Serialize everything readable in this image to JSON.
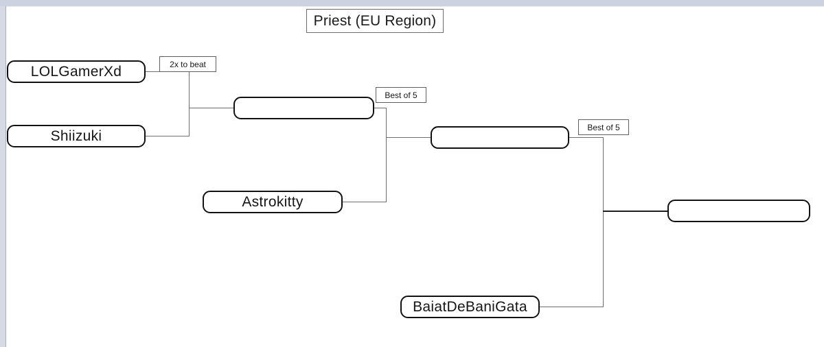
{
  "window": {
    "chrome_color": "#ccd2e0",
    "rail_color": "#d6dae4",
    "canvas_color": "#ffffff"
  },
  "bracket": {
    "title": "Priest (EU Region)",
    "line_color": "#6d6d6d",
    "box_border_color": "#111111",
    "rounds": [
      {
        "name": "round-1",
        "slots": [
          {
            "id": "slot-lolgamerxd",
            "label": "LOLGamerXd"
          },
          {
            "id": "slot-shiizuki",
            "label": "Shiizuki"
          }
        ]
      },
      {
        "name": "round-2",
        "slots": [
          {
            "id": "slot-r2-winner",
            "label": ""
          },
          {
            "id": "slot-astrokitty",
            "label": "Astrokitty"
          }
        ]
      },
      {
        "name": "round-3",
        "slots": [
          {
            "id": "slot-r3-winner",
            "label": ""
          },
          {
            "id": "slot-baiatdebanigata",
            "label": "BaiatDeBaniGata"
          }
        ]
      },
      {
        "name": "final",
        "slots": [
          {
            "id": "slot-champion",
            "label": ""
          }
        ]
      }
    ],
    "notes": [
      {
        "id": "note-2x-to-beat",
        "label": "2x to beat"
      },
      {
        "id": "note-best-of-5-semi",
        "label": "Best of 5"
      },
      {
        "id": "note-best-of-5-final",
        "label": "Best of 5"
      }
    ]
  }
}
